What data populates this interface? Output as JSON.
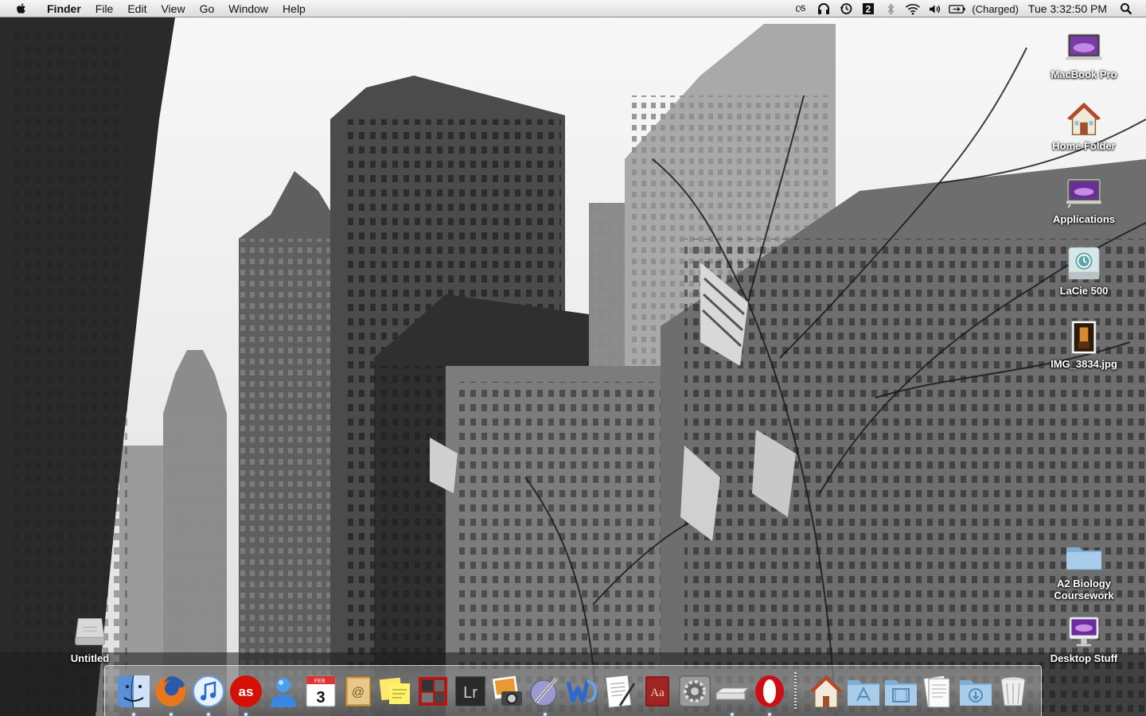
{
  "menubar": {
    "app_name": "Finder",
    "menus": [
      "File",
      "Edit",
      "View",
      "Go",
      "Window",
      "Help"
    ],
    "battery_status": "(Charged)",
    "clock": "Tue 3:32:50 PM"
  },
  "desktop": {
    "icons": [
      {
        "label": "MacBook Pro",
        "icon": "hard-drive-icon"
      },
      {
        "label": "Home Folder",
        "icon": "home-folder-icon"
      },
      {
        "label": "Applications",
        "icon": "applications-icon"
      },
      {
        "label": "LaCie 500",
        "icon": "time-machine-drive-icon"
      },
      {
        "label": "IMG_3834.jpg",
        "icon": "image-file-icon"
      },
      {
        "label": "A2 Biology\nCoursework",
        "icon": "folder-icon"
      },
      {
        "label": "Desktop Stuff",
        "icon": "imac-icon"
      },
      {
        "label": "Untitled",
        "icon": "disk-image-icon"
      }
    ]
  },
  "dock": {
    "apps": [
      {
        "name": "finder",
        "running": true
      },
      {
        "name": "firefox",
        "running": true
      },
      {
        "name": "itunes",
        "running": true
      },
      {
        "name": "lastfm",
        "running": true
      },
      {
        "name": "ichat",
        "running": false
      },
      {
        "name": "ical",
        "running": false
      },
      {
        "name": "address-book",
        "running": false
      },
      {
        "name": "stickies",
        "running": false
      },
      {
        "name": "photo-booth",
        "running": false
      },
      {
        "name": "lightroom",
        "running": false
      },
      {
        "name": "iphoto",
        "running": false
      },
      {
        "name": "script-editor",
        "running": true
      },
      {
        "name": "word",
        "running": false
      },
      {
        "name": "textedit",
        "running": false
      },
      {
        "name": "dictionary",
        "running": false
      },
      {
        "name": "system-preferences",
        "running": false
      },
      {
        "name": "scanner",
        "running": true
      },
      {
        "name": "opera",
        "running": true
      },
      {
        "name": "home-stack",
        "running": false
      },
      {
        "name": "applications-stack",
        "running": false
      },
      {
        "name": "movies-stack",
        "running": false
      },
      {
        "name": "documents-stack",
        "running": false
      },
      {
        "name": "downloads-stack",
        "running": false
      },
      {
        "name": "trash",
        "running": false
      }
    ],
    "calendar_month": "FEB",
    "calendar_day": "3",
    "lightroom_text": "Lr",
    "dictionary_text": "Aa",
    "lastfm_text": "as"
  },
  "colors": {
    "menubar_top": "#f6f6f6",
    "menubar_bottom": "#dcdcdc",
    "label_text": "#ffffff"
  }
}
